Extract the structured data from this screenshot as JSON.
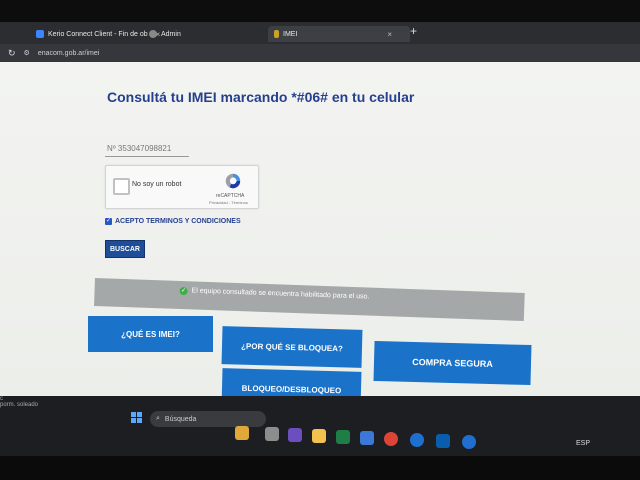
{
  "browser": {
    "tabs": [
      {
        "label": "Kerio Connect Client - Fin de ob"
      },
      {
        "label": "Admin"
      },
      {
        "label": "IMEI"
      }
    ],
    "new_tab": "+",
    "close_glyph": "×",
    "url": "enacom.gob.ar/imei"
  },
  "page": {
    "title": "Consultá tu IMEI marcando *#06# en tu celular",
    "imei_value": "Nº 353047098821",
    "captcha": {
      "label": "No soy un robot",
      "brand": "reCAPTCHA",
      "privacy": "Privacidad - Términos"
    },
    "terms_label": "ACEPTO TERMINOS Y CONDICIONES",
    "search_button": "BUSCAR",
    "status_message": "El equipo consultado se encuentra habilitado para el uso.",
    "buttons": {
      "imei": "¿QUÉ ES IMEI?",
      "bloquea": "¿POR QUÉ SE BLOQUEA?",
      "compra": "COMPRA SEGURA",
      "bloqueo": "BLOQUEO/DESBLOQUEO"
    }
  },
  "taskbar": {
    "search_label": "Búsqueda",
    "language": "ESP",
    "side_lines": [
      "c",
      "porm. soleado"
    ]
  },
  "colors": {
    "title": "#253f8f",
    "button_blue": "#1a72c9",
    "status_bg": "#a5a8a9",
    "status_ok": "#3fae49"
  }
}
